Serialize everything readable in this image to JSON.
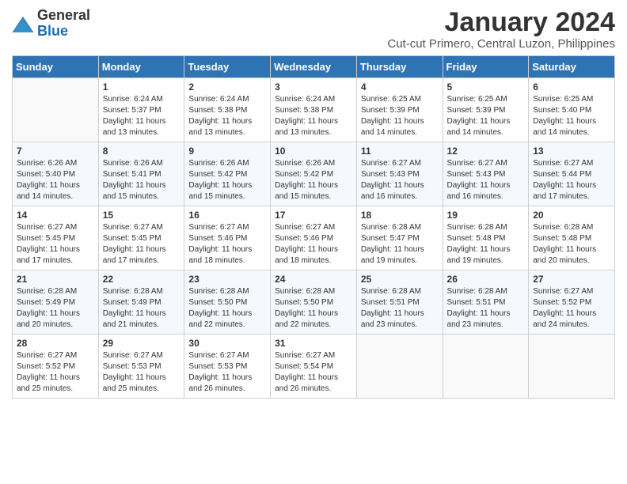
{
  "logo": {
    "general": "General",
    "blue": "Blue"
  },
  "title": "January 2024",
  "location": "Cut-cut Primero, Central Luzon, Philippines",
  "days_of_week": [
    "Sunday",
    "Monday",
    "Tuesday",
    "Wednesday",
    "Thursday",
    "Friday",
    "Saturday"
  ],
  "weeks": [
    [
      {
        "day": "",
        "sunrise": "",
        "sunset": "",
        "daylight": ""
      },
      {
        "day": "1",
        "sunrise": "Sunrise: 6:24 AM",
        "sunset": "Sunset: 5:37 PM",
        "daylight": "Daylight: 11 hours and 13 minutes."
      },
      {
        "day": "2",
        "sunrise": "Sunrise: 6:24 AM",
        "sunset": "Sunset: 5:38 PM",
        "daylight": "Daylight: 11 hours and 13 minutes."
      },
      {
        "day": "3",
        "sunrise": "Sunrise: 6:24 AM",
        "sunset": "Sunset: 5:38 PM",
        "daylight": "Daylight: 11 hours and 13 minutes."
      },
      {
        "day": "4",
        "sunrise": "Sunrise: 6:25 AM",
        "sunset": "Sunset: 5:39 PM",
        "daylight": "Daylight: 11 hours and 14 minutes."
      },
      {
        "day": "5",
        "sunrise": "Sunrise: 6:25 AM",
        "sunset": "Sunset: 5:39 PM",
        "daylight": "Daylight: 11 hours and 14 minutes."
      },
      {
        "day": "6",
        "sunrise": "Sunrise: 6:25 AM",
        "sunset": "Sunset: 5:40 PM",
        "daylight": "Daylight: 11 hours and 14 minutes."
      }
    ],
    [
      {
        "day": "7",
        "sunrise": "Sunrise: 6:26 AM",
        "sunset": "Sunset: 5:40 PM",
        "daylight": "Daylight: 11 hours and 14 minutes."
      },
      {
        "day": "8",
        "sunrise": "Sunrise: 6:26 AM",
        "sunset": "Sunset: 5:41 PM",
        "daylight": "Daylight: 11 hours and 15 minutes."
      },
      {
        "day": "9",
        "sunrise": "Sunrise: 6:26 AM",
        "sunset": "Sunset: 5:42 PM",
        "daylight": "Daylight: 11 hours and 15 minutes."
      },
      {
        "day": "10",
        "sunrise": "Sunrise: 6:26 AM",
        "sunset": "Sunset: 5:42 PM",
        "daylight": "Daylight: 11 hours and 15 minutes."
      },
      {
        "day": "11",
        "sunrise": "Sunrise: 6:27 AM",
        "sunset": "Sunset: 5:43 PM",
        "daylight": "Daylight: 11 hours and 16 minutes."
      },
      {
        "day": "12",
        "sunrise": "Sunrise: 6:27 AM",
        "sunset": "Sunset: 5:43 PM",
        "daylight": "Daylight: 11 hours and 16 minutes."
      },
      {
        "day": "13",
        "sunrise": "Sunrise: 6:27 AM",
        "sunset": "Sunset: 5:44 PM",
        "daylight": "Daylight: 11 hours and 17 minutes."
      }
    ],
    [
      {
        "day": "14",
        "sunrise": "Sunrise: 6:27 AM",
        "sunset": "Sunset: 5:45 PM",
        "daylight": "Daylight: 11 hours and 17 minutes."
      },
      {
        "day": "15",
        "sunrise": "Sunrise: 6:27 AM",
        "sunset": "Sunset: 5:45 PM",
        "daylight": "Daylight: 11 hours and 17 minutes."
      },
      {
        "day": "16",
        "sunrise": "Sunrise: 6:27 AM",
        "sunset": "Sunset: 5:46 PM",
        "daylight": "Daylight: 11 hours and 18 minutes."
      },
      {
        "day": "17",
        "sunrise": "Sunrise: 6:27 AM",
        "sunset": "Sunset: 5:46 PM",
        "daylight": "Daylight: 11 hours and 18 minutes."
      },
      {
        "day": "18",
        "sunrise": "Sunrise: 6:28 AM",
        "sunset": "Sunset: 5:47 PM",
        "daylight": "Daylight: 11 hours and 19 minutes."
      },
      {
        "day": "19",
        "sunrise": "Sunrise: 6:28 AM",
        "sunset": "Sunset: 5:48 PM",
        "daylight": "Daylight: 11 hours and 19 minutes."
      },
      {
        "day": "20",
        "sunrise": "Sunrise: 6:28 AM",
        "sunset": "Sunset: 5:48 PM",
        "daylight": "Daylight: 11 hours and 20 minutes."
      }
    ],
    [
      {
        "day": "21",
        "sunrise": "Sunrise: 6:28 AM",
        "sunset": "Sunset: 5:49 PM",
        "daylight": "Daylight: 11 hours and 20 minutes."
      },
      {
        "day": "22",
        "sunrise": "Sunrise: 6:28 AM",
        "sunset": "Sunset: 5:49 PM",
        "daylight": "Daylight: 11 hours and 21 minutes."
      },
      {
        "day": "23",
        "sunrise": "Sunrise: 6:28 AM",
        "sunset": "Sunset: 5:50 PM",
        "daylight": "Daylight: 11 hours and 22 minutes."
      },
      {
        "day": "24",
        "sunrise": "Sunrise: 6:28 AM",
        "sunset": "Sunset: 5:50 PM",
        "daylight": "Daylight: 11 hours and 22 minutes."
      },
      {
        "day": "25",
        "sunrise": "Sunrise: 6:28 AM",
        "sunset": "Sunset: 5:51 PM",
        "daylight": "Daylight: 11 hours and 23 minutes."
      },
      {
        "day": "26",
        "sunrise": "Sunrise: 6:28 AM",
        "sunset": "Sunset: 5:51 PM",
        "daylight": "Daylight: 11 hours and 23 minutes."
      },
      {
        "day": "27",
        "sunrise": "Sunrise: 6:27 AM",
        "sunset": "Sunset: 5:52 PM",
        "daylight": "Daylight: 11 hours and 24 minutes."
      }
    ],
    [
      {
        "day": "28",
        "sunrise": "Sunrise: 6:27 AM",
        "sunset": "Sunset: 5:52 PM",
        "daylight": "Daylight: 11 hours and 25 minutes."
      },
      {
        "day": "29",
        "sunrise": "Sunrise: 6:27 AM",
        "sunset": "Sunset: 5:53 PM",
        "daylight": "Daylight: 11 hours and 25 minutes."
      },
      {
        "day": "30",
        "sunrise": "Sunrise: 6:27 AM",
        "sunset": "Sunset: 5:53 PM",
        "daylight": "Daylight: 11 hours and 26 minutes."
      },
      {
        "day": "31",
        "sunrise": "Sunrise: 6:27 AM",
        "sunset": "Sunset: 5:54 PM",
        "daylight": "Daylight: 11 hours and 26 minutes."
      },
      {
        "day": "",
        "sunrise": "",
        "sunset": "",
        "daylight": ""
      },
      {
        "day": "",
        "sunrise": "",
        "sunset": "",
        "daylight": ""
      },
      {
        "day": "",
        "sunrise": "",
        "sunset": "",
        "daylight": ""
      }
    ]
  ]
}
